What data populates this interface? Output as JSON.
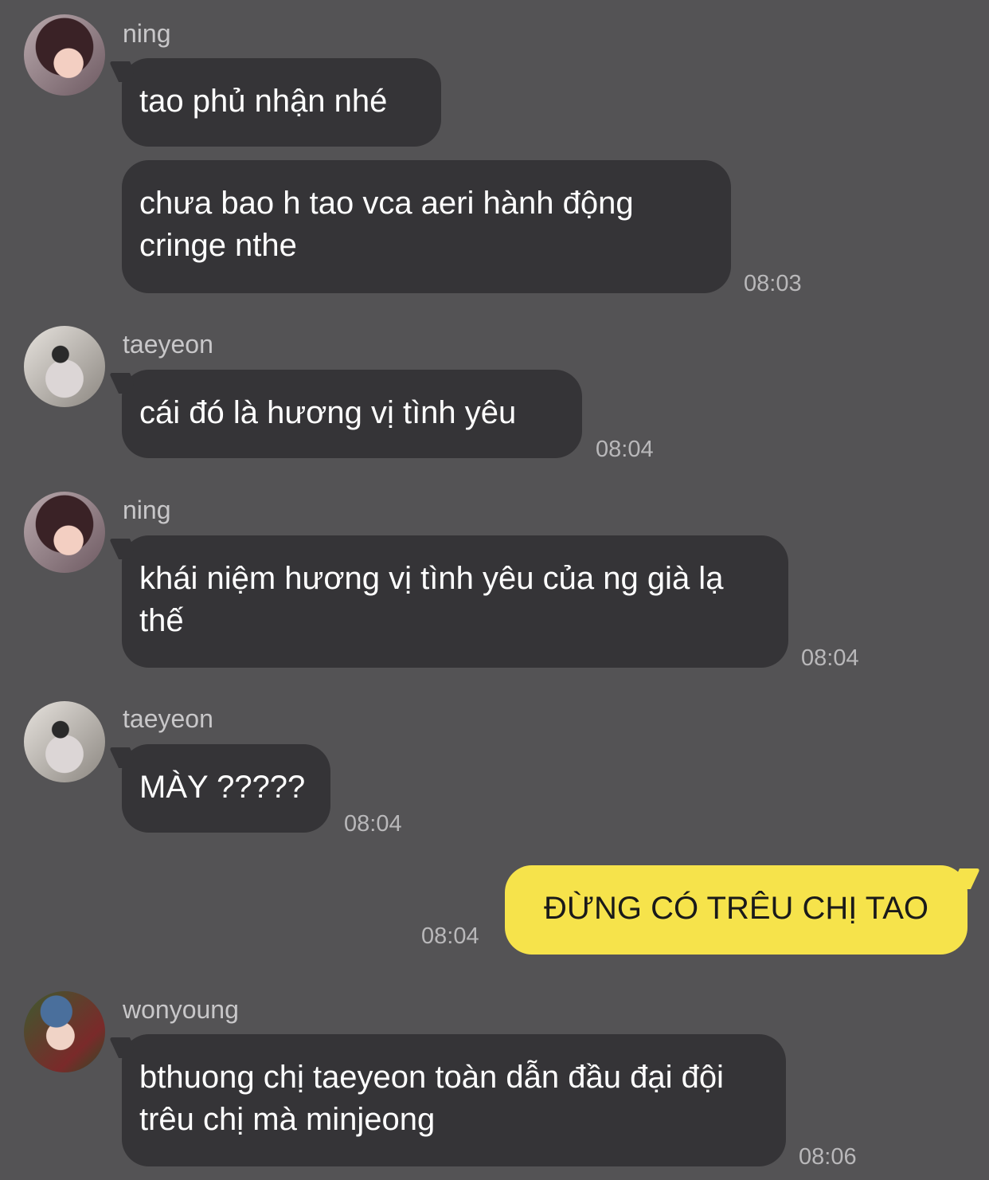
{
  "messages": [
    {
      "sender": "ning",
      "texts": [
        "tao phủ nhận nhé",
        "chưa bao h tao vca aeri hành động cringe nthe"
      ],
      "time": "08:03"
    },
    {
      "sender": "taeyeon",
      "texts": [
        "cái đó là hương vị tình yêu"
      ],
      "time": "08:04"
    },
    {
      "sender": "ning",
      "texts": [
        "khái niệm hương vị tình yêu của ng già lạ thế"
      ],
      "time": "08:04"
    },
    {
      "sender": "taeyeon",
      "texts": [
        "MÀY ?????"
      ],
      "time": "08:04"
    },
    {
      "sender": "me",
      "texts": [
        "ĐỪNG CÓ TRÊU CHỊ TAO"
      ],
      "time": "08:04"
    },
    {
      "sender": "wonyoung",
      "texts": [
        "bthuong chị taeyeon toàn dẫn đầu đại đội trêu chị mà minjeong"
      ],
      "time": "08:06"
    }
  ],
  "colors": {
    "background": "#545355",
    "incoming_bubble": "#353437",
    "outgoing_bubble": "#f6e34b"
  }
}
